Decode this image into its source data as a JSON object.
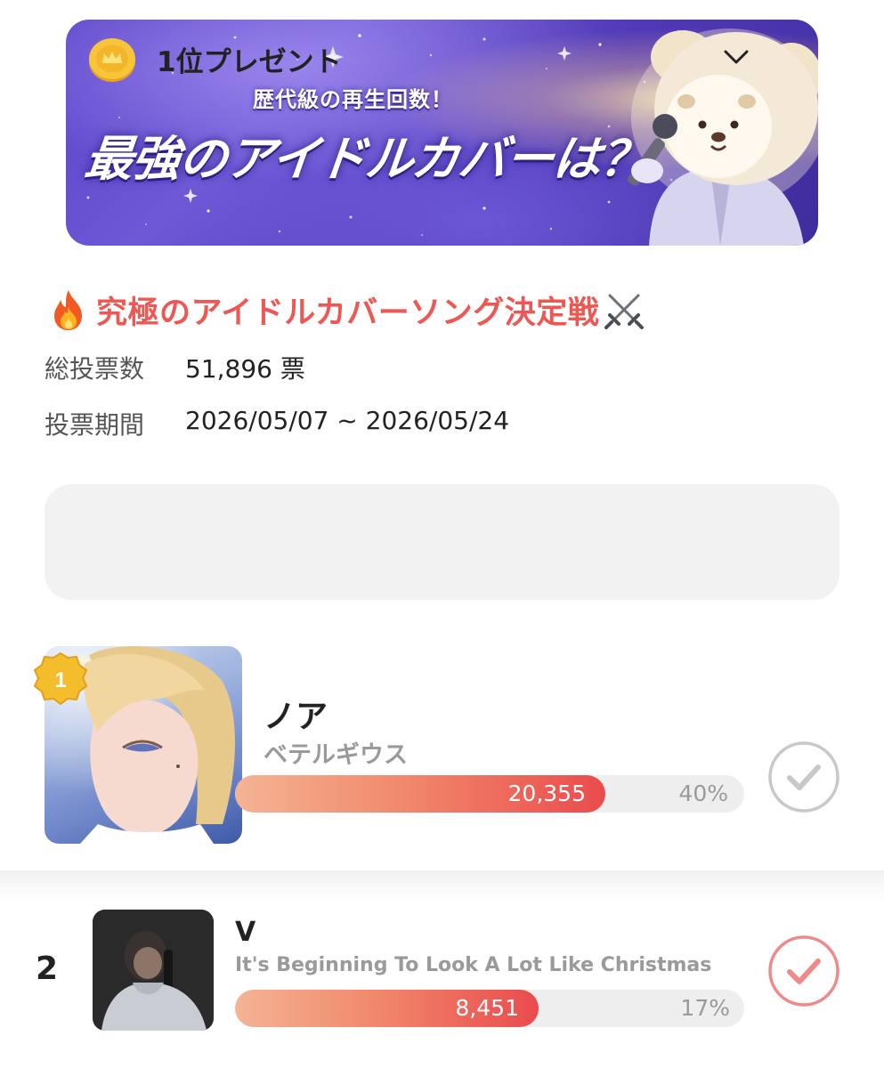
{
  "banner": {
    "subheading": "歴代級の再生回数！",
    "headline": "最強のアイドルカバーは？"
  },
  "poll": {
    "title": "究極のアイドルカバーソング決定戦",
    "title_icons": [
      "fire-icon",
      "crossed-swords-icon"
    ],
    "total_votes_label": "総投票数",
    "total_votes_value": "51,896 票",
    "period_label": "投票期間",
    "period_value": "2026/05/07 ~ 2026/05/24"
  },
  "prize": {
    "icon": "gold-coin-crown-icon",
    "label": "1位プレゼント",
    "toggle_icon": "chevron-down-icon"
  },
  "entries": [
    {
      "rank": "1",
      "name": "ノア",
      "song": "ベテルギウス",
      "votes": "20,355",
      "percent": "40%",
      "fill_fraction": 0.4,
      "checked": false
    },
    {
      "rank": "2",
      "name": "V",
      "song": "It's Beginning To Look A Lot Like Christmas",
      "votes": "8,451",
      "percent": "17%",
      "fill_fraction": 0.17,
      "checked": true
    }
  ],
  "colors": {
    "accent": "#ee5753",
    "bar_start": "#f4b494",
    "bar_end": "#ea4b4e",
    "check_inactive": "#c8c8c8",
    "check_active": "#ef8a8a",
    "prize_bg": "#f2f2f2"
  }
}
